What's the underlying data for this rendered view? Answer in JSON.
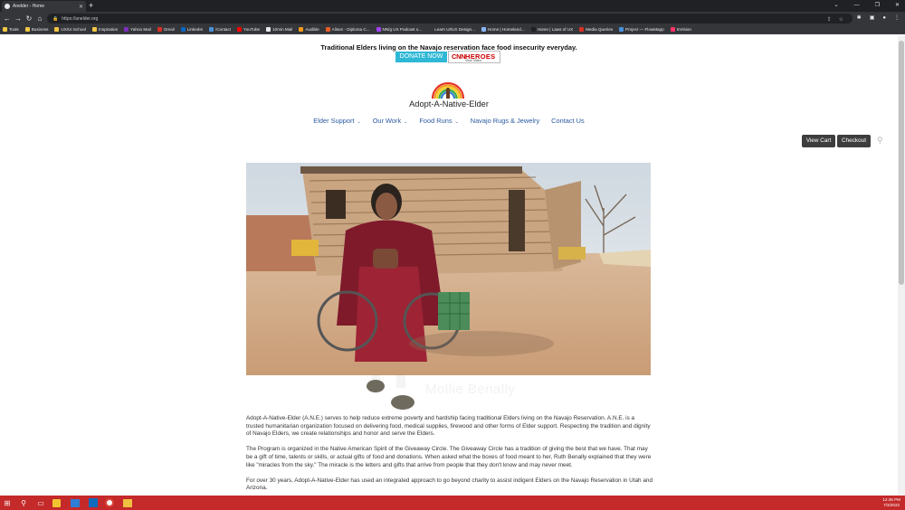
{
  "browser": {
    "tab_title": "Anelder - Home",
    "url": "https://anelder.org",
    "bookmarks": [
      {
        "label": "Tools",
        "color": "#f2c744"
      },
      {
        "label": "Business",
        "color": "#f2c744"
      },
      {
        "label": "UX/UI School",
        "color": "#f2c744"
      },
      {
        "label": "Inspiration",
        "color": "#f2c744"
      },
      {
        "label": "Yahoo Mail",
        "color": "#7b2fbe"
      },
      {
        "label": "Gmail",
        "color": "#d93025"
      },
      {
        "label": "LinkedIn",
        "color": "#0a66c2"
      },
      {
        "label": "iContact",
        "color": "#4a90d9"
      },
      {
        "label": "YouTube",
        "color": "#ff0000"
      },
      {
        "label": "10min Mail",
        "color": "#e8eaed"
      },
      {
        "label": "Audible",
        "color": "#f29a1b"
      },
      {
        "label": "Alison - Diploma C...",
        "color": "#e85d2a"
      },
      {
        "label": "NN/g UX Podcast o...",
        "color": "#a142f4"
      },
      {
        "label": "Learn UI/UX Design...",
        "color": "#35363a"
      },
      {
        "label": "Home | Homeland...",
        "color": "#8ab4f8"
      },
      {
        "label": "Home | Laws of UX",
        "color": "#202124"
      },
      {
        "label": "Media Queries",
        "color": "#d93025"
      },
      {
        "label": "Project — FlowMapp",
        "color": "#4a90d9"
      },
      {
        "label": "InVision",
        "color": "#ff3366"
      }
    ]
  },
  "banner": {
    "announcement": "Traditional Elders living on the Navajo reservation face food insecurity everyday.",
    "donate_label": "DONATE NOW",
    "cnn_logo": "CNN",
    "cnn_heroes": "HEROES",
    "cnn_video": "View Video"
  },
  "site": {
    "title": "Adopt-A-Native-Elder"
  },
  "nav": [
    {
      "label": "Elder Support",
      "dropdown": true
    },
    {
      "label": "Our Work",
      "dropdown": true
    },
    {
      "label": "Food Runs",
      "dropdown": true
    },
    {
      "label": "Navajo Rugs & Jewelry",
      "dropdown": false
    },
    {
      "label": "Contact Us",
      "dropdown": false
    }
  ],
  "cart": {
    "view_cart": "View Cart",
    "checkout": "Checkout"
  },
  "hero": {
    "ghost_text": "Mollie Benally"
  },
  "content": {
    "p1": "Adopt-A-Native-Elder (A.N.E.) serves to help reduce extreme poverty and hardship facing traditional Elders living on the Navajo Reservation. A.N.E. is a trusted humanitarian organization focused on delivering food, medical supplies, firewood and other forms of Elder support. Respecting the tradition and dignity of Navajo Elders, we create relationships and honor and serve the Elders.",
    "p2": "The Program is organized in the Native American Spirit of the Giveaway Circle. The Giveaway Circle has a tradition of giving the best that we have. That may be a gift of time, talents or skills, or actual gifts of food and donations. When asked what the boxes of food meant to her, Ruth Benally explained that they were like \"miracles from the sky.\" The miracle is the letters and gifts that arrive from people that they don't know and may never meet.",
    "p3": "For over 30 years, Adopt-A-Native-Elder has used an integrated approach to go beyond charity to assist indigent Elders on the Navajo Reservation in Utah and Arizona."
  },
  "taskbar": {
    "time": "12:45 PM",
    "date": "7/3/2022"
  }
}
